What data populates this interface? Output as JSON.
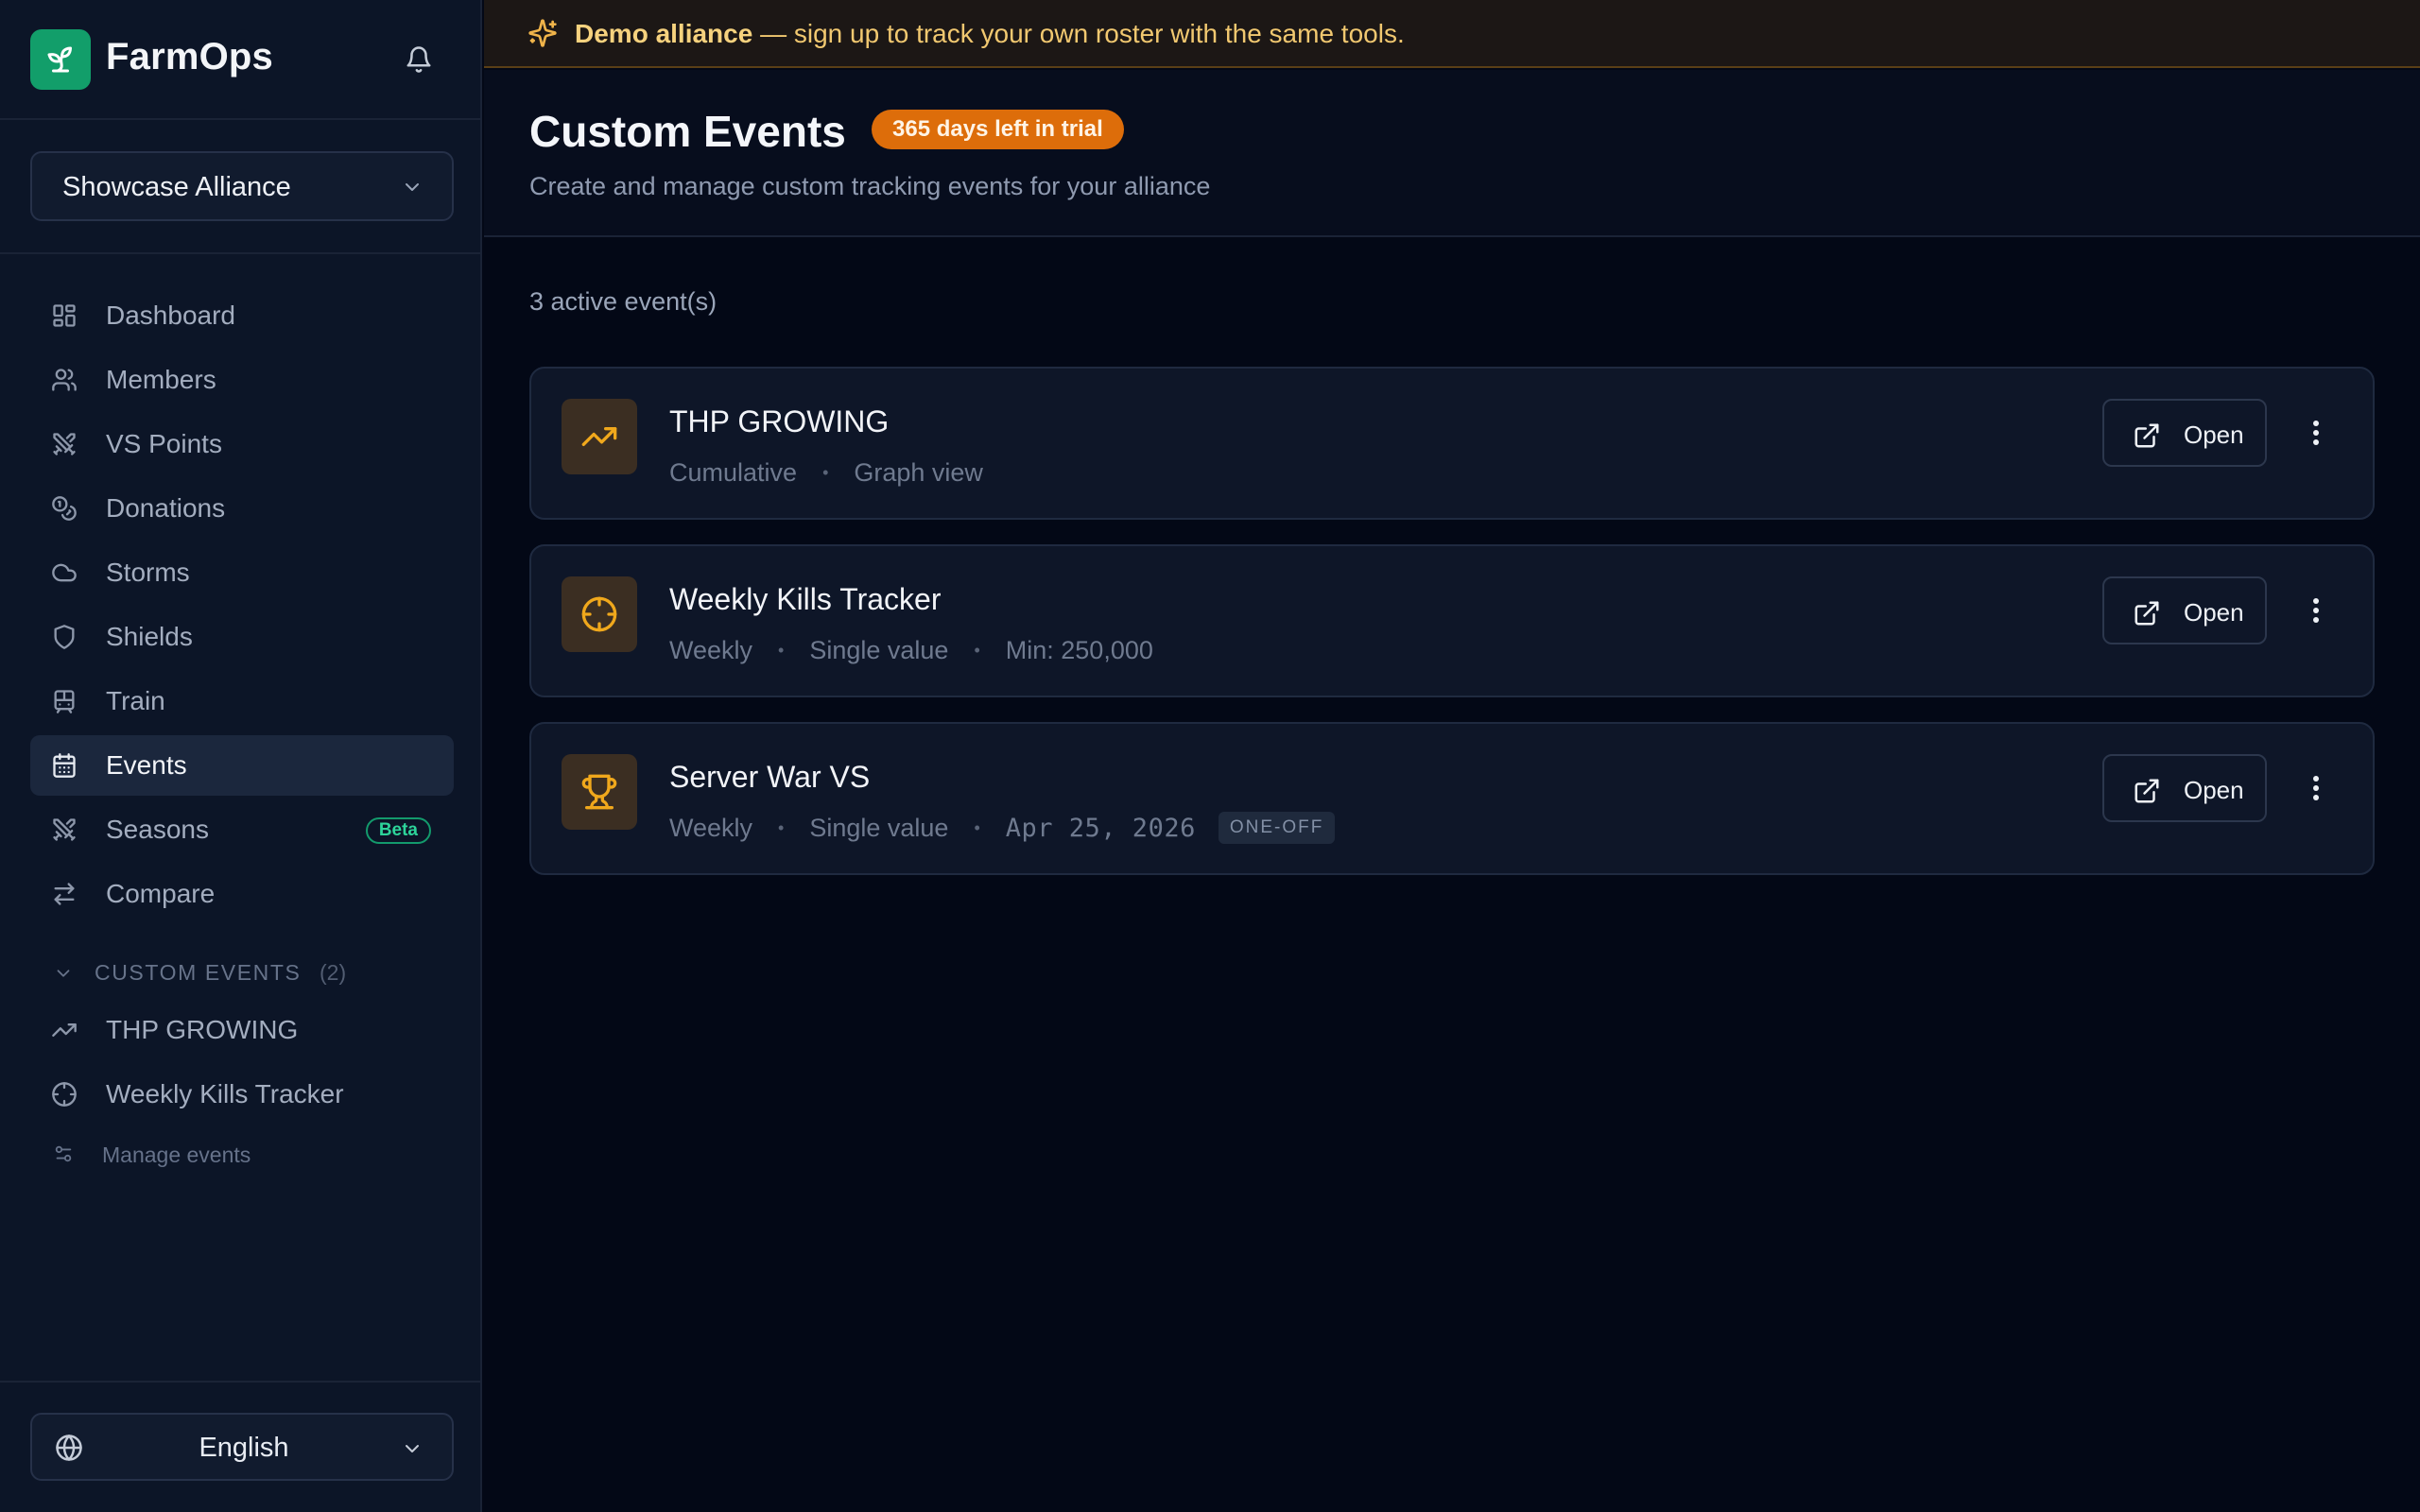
{
  "app": {
    "name": "FarmOps",
    "alliance_selected": "Showcase Alliance"
  },
  "sidebar": {
    "nav": [
      {
        "label": "Dashboard",
        "icon": "dashboard-icon"
      },
      {
        "label": "Members",
        "icon": "users-icon"
      },
      {
        "label": "VS Points",
        "icon": "crossed-swords-icon"
      },
      {
        "label": "Donations",
        "icon": "coins-icon"
      },
      {
        "label": "Storms",
        "icon": "cloud-icon"
      },
      {
        "label": "Shields",
        "icon": "shield-icon"
      },
      {
        "label": "Train",
        "icon": "train-icon"
      },
      {
        "label": "Events",
        "icon": "calendar-icon",
        "active": true
      },
      {
        "label": "Seasons",
        "icon": "crossed-swords-icon",
        "badge": "Beta"
      },
      {
        "label": "Compare",
        "icon": "arrows-swap-icon"
      }
    ],
    "custom_events": {
      "title": "CUSTOM EVENTS",
      "count": "(2)",
      "items": [
        {
          "label": "THP GROWING",
          "icon": "trending-up-icon"
        },
        {
          "label": "Weekly Kills Tracker",
          "icon": "crosshair-icon"
        }
      ],
      "manage_label": "Manage events"
    },
    "language": "English"
  },
  "banner": {
    "strong": "Demo alliance",
    "text": " — sign up to track your own roster with the same tools."
  },
  "page": {
    "title": "Custom Events",
    "trial_badge": "365 days left in trial",
    "subtitle": "Create and manage custom tracking events for your alliance",
    "active_count": "3 active event(s)"
  },
  "events": [
    {
      "name": "THP GROWING",
      "icon": "trending-up-icon",
      "meta": [
        "Cumulative",
        "Graph view"
      ],
      "open_label": "Open"
    },
    {
      "name": "Weekly Kills Tracker",
      "icon": "crosshair-icon",
      "meta": [
        "Weekly",
        "Single value",
        "Min: 250,000"
      ],
      "open_label": "Open"
    },
    {
      "name": "Server War VS",
      "icon": "trophy-icon",
      "meta": [
        "Weekly",
        "Single value"
      ],
      "date": "Apr 25, 2026",
      "tag": "ONE-OFF",
      "open_label": "Open"
    }
  ],
  "colors": {
    "brand": "#129e6a",
    "accent_orange": "#dd6d0a",
    "event_icon": "#f0a81c",
    "banner_text": "#f1c870"
  }
}
